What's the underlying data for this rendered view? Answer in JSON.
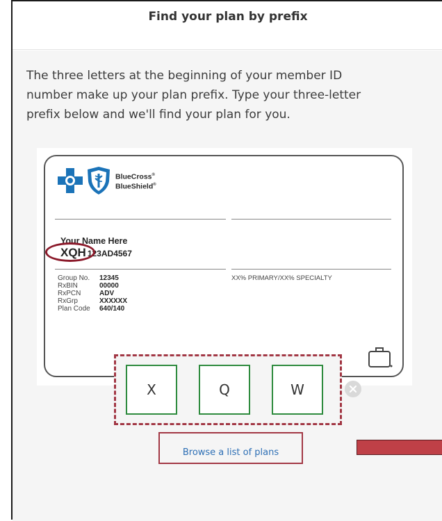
{
  "header": {
    "title": "Find your plan by prefix"
  },
  "instructions": "The three letters at the beginning of your member ID number make up your plan prefix. Type your three-letter prefix below and we'll find your plan for you.",
  "card": {
    "brand_line1": "BlueCross",
    "brand_line2": "BlueShield",
    "member_name": "Your Name Here",
    "id_prefix": "XQH",
    "id_rest": "123AD4567",
    "coverage": "XX% PRIMARY/XX% SPECIALTY",
    "details": [
      {
        "label": "Group No.",
        "value": "12345"
      },
      {
        "label": "RxBIN",
        "value": "00000"
      },
      {
        "label": "RxPCN",
        "value": "ADV"
      },
      {
        "label": "RxGrp",
        "value": "XXXXXX"
      },
      {
        "label": "Plan Code",
        "value": "640/140"
      }
    ],
    "icons": [
      "bluecross-logo-icon",
      "blueshield-logo-icon",
      "briefcase-icon"
    ]
  },
  "prefix_inputs": {
    "values": [
      "X",
      "Q",
      "W"
    ],
    "clear_icon": "clear-x-icon"
  },
  "browse_link": {
    "label": "Browse a list of plans"
  },
  "colors": {
    "brand_blue": "#1b73b8",
    "input_border": "#2e8b3e",
    "highlight": "#a23744",
    "link": "#2d6fb5"
  }
}
